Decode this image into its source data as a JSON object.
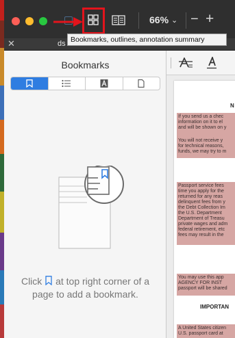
{
  "toolbar": {
    "zoom_value": "66%",
    "zoom_chevron": "⌄",
    "zoom_minus": "−",
    "zoom_plus": "+"
  },
  "tooltip": {
    "text": "Bookmarks, outlines, annotation summary"
  },
  "tabs": {
    "close_glyph": "✕",
    "active_tab_label": "ds"
  },
  "sidebar": {
    "title": "Bookmarks",
    "segments": [
      {
        "name": "bookmarks",
        "icon": "bookmark-icon",
        "active": true
      },
      {
        "name": "outlines",
        "icon": "list-icon",
        "active": false
      },
      {
        "name": "annotations",
        "icon": "annotation-icon",
        "active": false
      },
      {
        "name": "pages",
        "icon": "page-icon",
        "active": false
      }
    ],
    "hint_before": "Click",
    "hint_after": "at top right corner of a page to add a bookmark."
  },
  "document": {
    "heading_fragment": "N",
    "block1_lines": [
      "If you send us a chec",
      "information on it to el",
      "and will be shown on y",
      "",
      "You will not receive y",
      "for technical reasons,",
      "funds, we may try to m"
    ],
    "block2_lines": [
      "Passport service fees",
      "time you apply for the",
      "returned for any reas",
      "delinquent fees from y",
      "the Debt Collection Im",
      "the U.S. Department",
      "Department of Treasu",
      "private wages and adm",
      "federal retirement, etc",
      "fees may result in the"
    ],
    "block3_lines": [
      "You may use this app",
      "AGENCY FOR INST",
      "passport will be shared"
    ],
    "heading2_fragment": "IMPORTAN",
    "block4_lines": [
      "A United States citizen",
      "U.S. passport card at"
    ]
  },
  "colors": {
    "accent": "#2f7de1",
    "highlight_box": "#e3141c",
    "doc_highlight": "#d6a6a3"
  }
}
